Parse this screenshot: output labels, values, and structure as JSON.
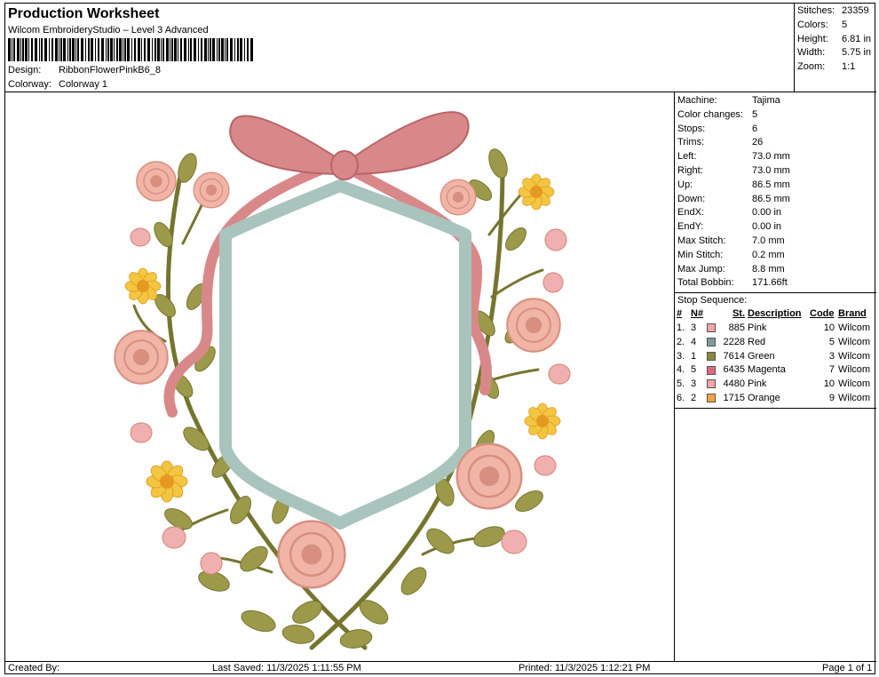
{
  "header": {
    "title": "Production Worksheet",
    "subtitle": "Wilcom EmbroideryStudio – Level 3 Advanced",
    "design_label": "Design:",
    "design_value": "RibbonFlowerPinkB6_8",
    "colorway_label": "Colorway:",
    "colorway_value": "Colorway 1"
  },
  "stats": [
    {
      "label": "Stitches:",
      "value": "23359"
    },
    {
      "label": "Colors:",
      "value": "5"
    },
    {
      "label": "Height:",
      "value": "6.81 in"
    },
    {
      "label": "Width:",
      "value": "5.75 in"
    },
    {
      "label": "Zoom:",
      "value": "1:1"
    }
  ],
  "machine": [
    {
      "label": "Machine:",
      "value": "Tajima"
    },
    {
      "label": "Color changes:",
      "value": "5"
    },
    {
      "label": "Stops:",
      "value": "6"
    },
    {
      "label": "Trims:",
      "value": "26"
    },
    {
      "label": "Left:",
      "value": "73.0 mm"
    },
    {
      "label": "Right:",
      "value": "73.0 mm"
    },
    {
      "label": "Up:",
      "value": "86.5 mm"
    },
    {
      "label": "Down:",
      "value": "86.5 mm"
    },
    {
      "label": "EndX:",
      "value": "0.00 in"
    },
    {
      "label": "EndY:",
      "value": "0.00 in"
    },
    {
      "label": "Max Stitch:",
      "value": "7.0 mm"
    },
    {
      "label": "Min Stitch:",
      "value": "0.2 mm"
    },
    {
      "label": "Max Jump:",
      "value": "8.8 mm"
    },
    {
      "label": "Total Bobbin:",
      "value": "171.66ft"
    }
  ],
  "stop_sequence": {
    "title": "Stop Sequence:",
    "headers": {
      "idx": "#",
      "n": "N#",
      "st": "St.",
      "desc": "Description",
      "code": "Code",
      "brand": "Brand"
    },
    "rows": [
      {
        "idx": "1.",
        "n": "3",
        "color": "#f2a5a5",
        "st": "885",
        "desc": "Pink",
        "code": "10",
        "brand": "Wilcom"
      },
      {
        "idx": "2.",
        "n": "4",
        "color": "#7f9a98",
        "st": "2228",
        "desc": "Red",
        "code": "5",
        "brand": "Wilcom"
      },
      {
        "idx": "3.",
        "n": "1",
        "color": "#8a8a3e",
        "st": "7614",
        "desc": "Green",
        "code": "3",
        "brand": "Wilcom"
      },
      {
        "idx": "4.",
        "n": "5",
        "color": "#e06a82",
        "st": "6435",
        "desc": "Magenta",
        "code": "7",
        "brand": "Wilcom"
      },
      {
        "idx": "5.",
        "n": "3",
        "color": "#f2a5a5",
        "st": "4480",
        "desc": "Pink",
        "code": "10",
        "brand": "Wilcom"
      },
      {
        "idx": "6.",
        "n": "2",
        "color": "#f5a340",
        "st": "1715",
        "desc": "Orange",
        "code": "9",
        "brand": "Wilcom"
      }
    ]
  },
  "footer": {
    "created_by": "Created By:",
    "last_saved": "Last Saved: 11/3/2025 1:11:55 PM",
    "printed": "Printed: 11/3/2025 1:12:21 PM",
    "page": "Page 1 of 1"
  },
  "design_colors": {
    "ribbon": "#d9888a",
    "ribbon_dark": "#b86468",
    "frame": "#a9c4bd",
    "frame_dark": "#7f9a95",
    "leaf": "#9c9a4a",
    "leaf_dark": "#76752f",
    "rose": "#f0b5a6",
    "rose_dark": "#d88f80",
    "daisy": "#f2c640",
    "daisy_center": "#e49a1f",
    "bud": "#f0b0b0"
  }
}
